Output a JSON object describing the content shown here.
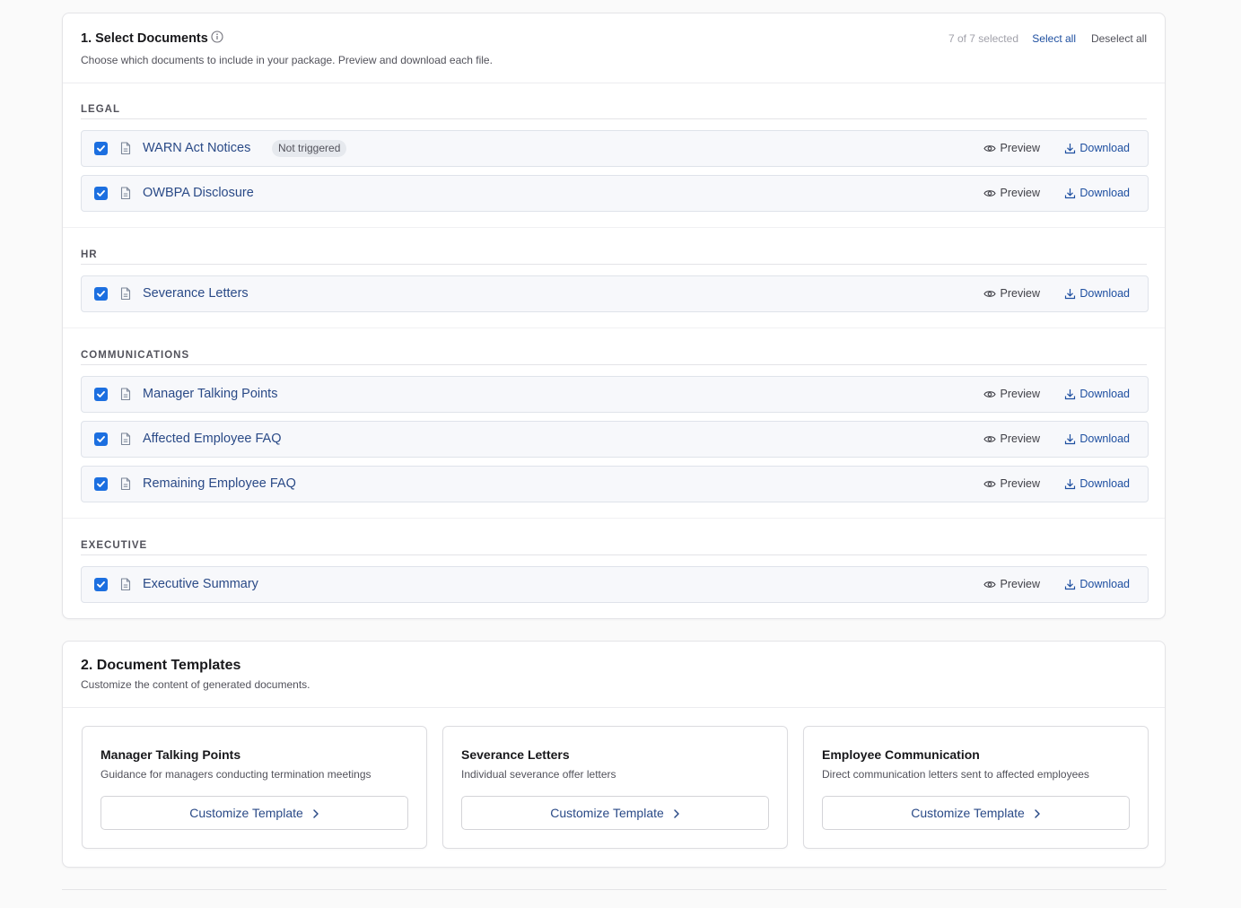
{
  "select_documents": {
    "title": "1. Select Documents",
    "subtitle": "Choose which documents to include in your package. Preview and download each file.",
    "selected_count": "7 of 7 selected",
    "select_all_label": "Select all",
    "deselect_all_label": "Deselect all",
    "preview_label": "Preview",
    "download_label": "Download",
    "sections": [
      {
        "label": "LEGAL",
        "docs": [
          {
            "name": "WARN Act Notices",
            "badge": "Not triggered",
            "checked": true
          },
          {
            "name": "OWBPA Disclosure",
            "checked": true
          }
        ]
      },
      {
        "label": "HR",
        "docs": [
          {
            "name": "Severance Letters",
            "checked": true
          }
        ]
      },
      {
        "label": "COMMUNICATIONS",
        "docs": [
          {
            "name": "Manager Talking Points",
            "checked": true
          },
          {
            "name": "Affected Employee FAQ",
            "checked": true
          },
          {
            "name": "Remaining Employee FAQ",
            "checked": true
          }
        ]
      },
      {
        "label": "EXECUTIVE",
        "docs": [
          {
            "name": "Executive Summary",
            "checked": true
          }
        ]
      }
    ]
  },
  "document_templates": {
    "title": "2. Document Templates",
    "subtitle": "Customize the content of generated documents.",
    "button_label": "Customize Template",
    "templates": [
      {
        "title": "Manager Talking Points",
        "description": "Guidance for managers conducting termination meetings"
      },
      {
        "title": "Severance Letters",
        "description": "Individual severance offer letters"
      },
      {
        "title": "Employee Communication",
        "description": "Direct communication letters sent to affected employees"
      }
    ]
  },
  "colors": {
    "accent": "#1c6fe0",
    "link": "#1e4fa0",
    "doc_text": "#2a4a87"
  }
}
